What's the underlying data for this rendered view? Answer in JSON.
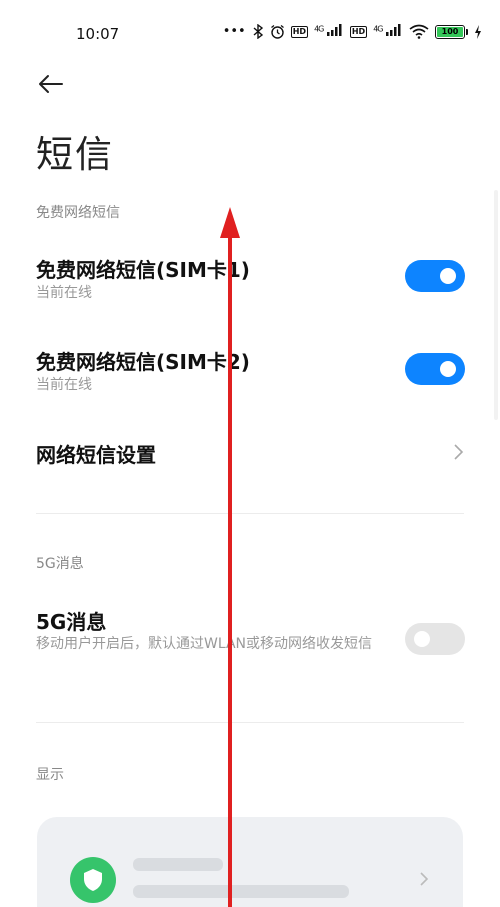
{
  "status_bar": {
    "time": "10:07",
    "dots": "•••",
    "hd1": "HD",
    "net1": "4G",
    "hd2": "HD",
    "net2": "4G",
    "battery": "100",
    "icons": [
      "bluetooth-icon",
      "alarm-icon",
      "signal-icon",
      "wifi-icon",
      "battery-icon",
      "charging-icon"
    ]
  },
  "header": {
    "title": "短信"
  },
  "sections": {
    "free_sms": {
      "header": "免费网络短信",
      "items": [
        {
          "title": "免费网络短信(SIM卡1)",
          "subtitle": "当前在线",
          "toggle": "on"
        },
        {
          "title": "免费网络短信(SIM卡2)",
          "subtitle": "当前在线",
          "toggle": "on"
        }
      ],
      "settings_label": "网络短信设置"
    },
    "fiveg": {
      "header": "5G消息",
      "item_title": "5G消息",
      "item_subtitle": "移动用户开启后，默认通过WLAN或移动网络收发短信",
      "toggle": "off"
    },
    "display": {
      "header": "显示"
    }
  },
  "colors": {
    "toggle_on": "#0d84ff",
    "toggle_off": "#e5e5e5",
    "annotation_arrow": "#e02020",
    "shield_green": "#36c46b"
  }
}
